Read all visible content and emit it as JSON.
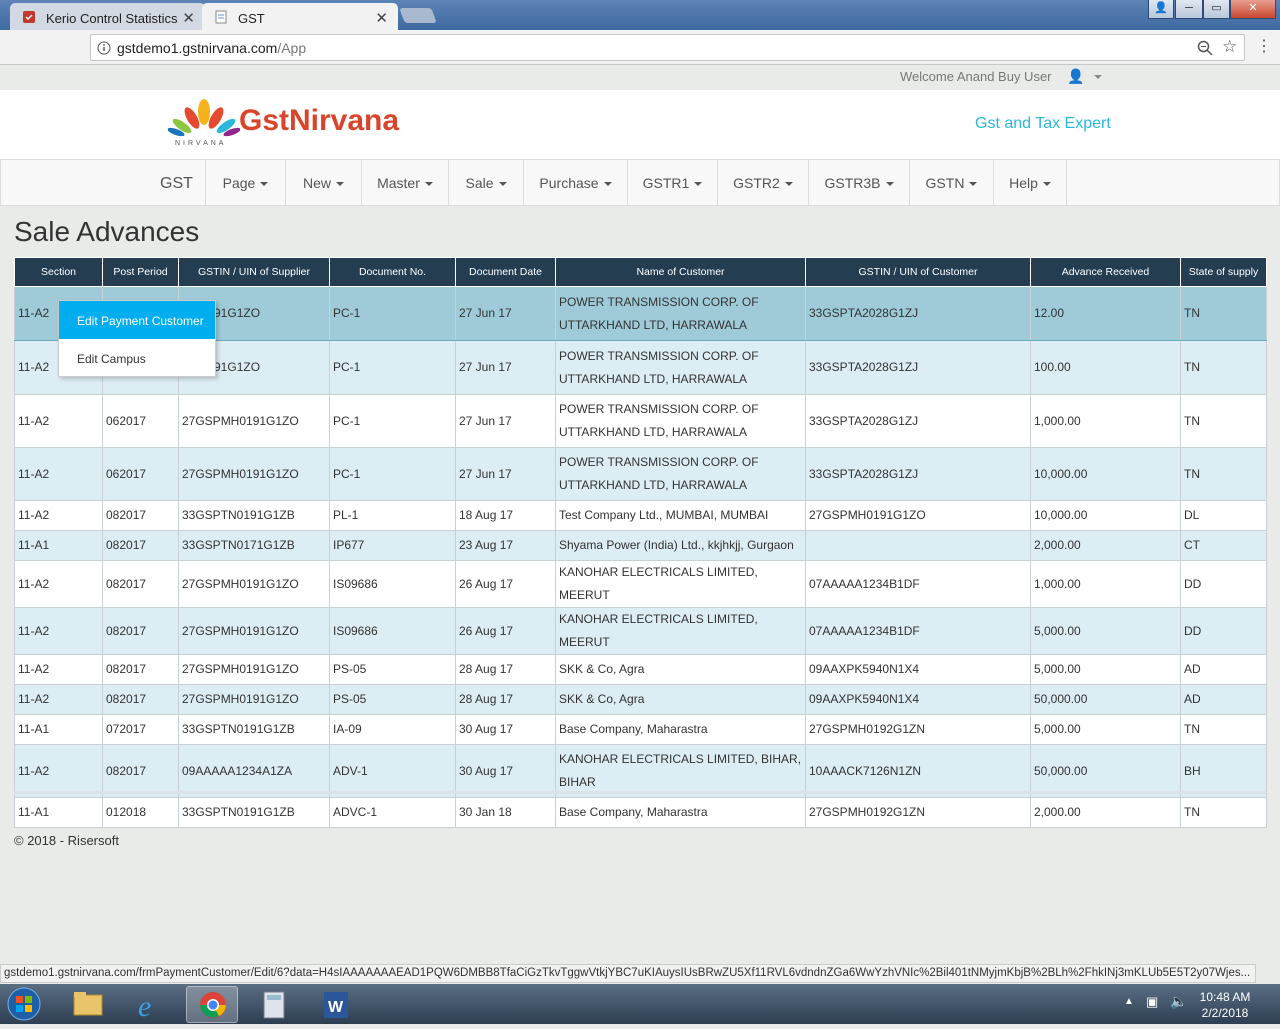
{
  "browser": {
    "tabs": [
      {
        "label": "Kerio Control Statistics",
        "close": "✕"
      },
      {
        "label": "GST",
        "close": "✕"
      }
    ],
    "url_host": "gstdemo1.gstnirvana.com",
    "url_path": "/App",
    "window_buttons": [
      "─",
      "▭",
      "✕"
    ]
  },
  "topbar": {
    "welcome": "Welcome Anand Buy User"
  },
  "header": {
    "logo": "GstNirvana",
    "logo_sub": "NIRVANA",
    "tagline": "Gst and Tax Expert"
  },
  "nav": {
    "brand": "GST",
    "menus": [
      "Page",
      "New",
      "Master",
      "Sale",
      "Purchase",
      "GSTR1",
      "GSTR2",
      "GSTR3B",
      "GSTN",
      "Help"
    ]
  },
  "page": {
    "title": "Sale Advances"
  },
  "table": {
    "columns": [
      "Section",
      "Post Period",
      "GSTIN / UIN of Supplier",
      "Document No.",
      "Document Date",
      "Name of Customer",
      "GSTIN / UIN of Customer",
      "Advance Received",
      "State of supply"
    ],
    "rows": [
      {
        "section": "11-A2",
        "period": "",
        "supplier": "MH0191G1ZO",
        "doc": "PC-1",
        "date": "27 Jun 17",
        "customer": [
          "POWER TRANSMISSION CORP. OF",
          "UTTARKHAND LTD, HARRAWALA"
        ],
        "cust_gstin": "33GSPTA2028G1ZJ",
        "amount": "12.00",
        "state": "TN"
      },
      {
        "section": "11-A2",
        "period": "",
        "supplier": "MH0191G1ZO",
        "doc": "PC-1",
        "date": "27 Jun 17",
        "customer": [
          "POWER TRANSMISSION CORP. OF",
          "UTTARKHAND LTD, HARRAWALA"
        ],
        "cust_gstin": "33GSPTA2028G1ZJ",
        "amount": "100.00",
        "state": "TN"
      },
      {
        "section": "11-A2",
        "period": "062017",
        "supplier": "27GSPMH0191G1ZO",
        "doc": "PC-1",
        "date": "27 Jun 17",
        "customer": [
          "POWER TRANSMISSION CORP. OF",
          "UTTARKHAND LTD, HARRAWALA"
        ],
        "cust_gstin": "33GSPTA2028G1ZJ",
        "amount": "1,000.00",
        "state": "TN"
      },
      {
        "section": "11-A2",
        "period": "062017",
        "supplier": "27GSPMH0191G1ZO",
        "doc": "PC-1",
        "date": "27 Jun 17",
        "customer": [
          "POWER TRANSMISSION CORP. OF",
          "UTTARKHAND LTD, HARRAWALA"
        ],
        "cust_gstin": "33GSPTA2028G1ZJ",
        "amount": "10,000.00",
        "state": "TN"
      },
      {
        "section": "11-A2",
        "period": "082017",
        "supplier": "33GSPTN0191G1ZB",
        "doc": "PL-1",
        "date": "18 Aug 17",
        "customer": [
          "Test Company Ltd., MUMBAI, MUMBAI"
        ],
        "cust_gstin": "27GSPMH0191G1ZO",
        "amount": "10,000.00",
        "state": "DL"
      },
      {
        "section": "11-A1",
        "period": "082017",
        "supplier": "33GSPTN0171G1ZB",
        "doc": "IP677",
        "date": "23 Aug 17",
        "customer": [
          "Shyama Power (India) Ltd., kkjhkjj, Gurgaon"
        ],
        "cust_gstin": "",
        "amount": "2,000.00",
        "state": "CT"
      },
      {
        "section": "11-A2",
        "period": "082017",
        "supplier": "27GSPMH0191G1ZO",
        "doc": "IS09686",
        "date": "26 Aug 17",
        "customer": [
          "KANOHAR ELECTRICALS LIMITED, MEERUT"
        ],
        "cust_gstin": "07AAAAA1234B1DF",
        "amount": "1,000.00",
        "state": "DD"
      },
      {
        "section": "11-A2",
        "period": "082017",
        "supplier": "27GSPMH0191G1ZO",
        "doc": "IS09686",
        "date": "26 Aug 17",
        "customer": [
          "KANOHAR ELECTRICALS LIMITED, MEERUT"
        ],
        "cust_gstin": "07AAAAA1234B1DF",
        "amount": "5,000.00",
        "state": "DD"
      },
      {
        "section": "11-A2",
        "period": "082017",
        "supplier": "27GSPMH0191G1ZO",
        "doc": "PS-05",
        "date": "28 Aug 17",
        "customer": [
          "SKK & Co, Agra"
        ],
        "cust_gstin": "09AAXPK5940N1X4",
        "amount": "5,000.00",
        "state": "AD"
      },
      {
        "section": "11-A2",
        "period": "082017",
        "supplier": "27GSPMH0191G1ZO",
        "doc": "PS-05",
        "date": "28 Aug 17",
        "customer": [
          "SKK & Co, Agra"
        ],
        "cust_gstin": "09AAXPK5940N1X4",
        "amount": "50,000.00",
        "state": "AD"
      },
      {
        "section": "11-A1",
        "period": "072017",
        "supplier": "33GSPTN0191G1ZB",
        "doc": "IA-09",
        "date": "30 Aug 17",
        "customer": [
          "Base Company, Maharastra"
        ],
        "cust_gstin": "27GSPMH0192G1ZN",
        "amount": "5,000.00",
        "state": "TN"
      },
      {
        "section": "11-A2",
        "period": "082017",
        "supplier": "09AAAAA1234A1ZA",
        "doc": "ADV-1",
        "date": "30 Aug 17",
        "customer": [
          "KANOHAR ELECTRICALS LIMITED, BIHAR,",
          "BIHAR"
        ],
        "cust_gstin": "10AAACK7126N1ZN",
        "amount": "50,000.00",
        "state": "BH"
      },
      {
        "section": "11-A1",
        "period": "012018",
        "supplier": "33GSPTN0191G1ZB",
        "doc": "ADVC-1",
        "date": "30 Jan 18",
        "customer": [
          "Base Company, Maharastra"
        ],
        "cust_gstin": "27GSPMH0192G1ZN",
        "amount": "2,000.00",
        "state": "TN"
      }
    ]
  },
  "context_menu": [
    "Edit Payment Customer",
    "Edit Campus"
  ],
  "footer": "© 2018 - Risersoft",
  "status_url": "gstdemo1.gstnirvana.com/frmPaymentCustomer/Edit/6?data=H4sIAAAAAAAEAD1PQW6DMBB8TfaCiGzTkvTggwVtkjYBC7uKIAuysIUsBRwZU5Xf11RVL6vdndnZGa6WwYzhVNIc%2Bil401tNMyjmKbjB%2BLh%2FhkINj3mKLUb5E5T2y07Wjes...",
  "taskbar": {
    "time": "10:48 AM",
    "date": "2/2/2018"
  },
  "colors": {
    "header_row": "#253d50",
    "selected_row": "#9fcbd8",
    "alt_row": "#dcedf3",
    "menu_highlight": "#00aeef",
    "logo_red": "#d9452b",
    "tagline": "#29b8db"
  }
}
